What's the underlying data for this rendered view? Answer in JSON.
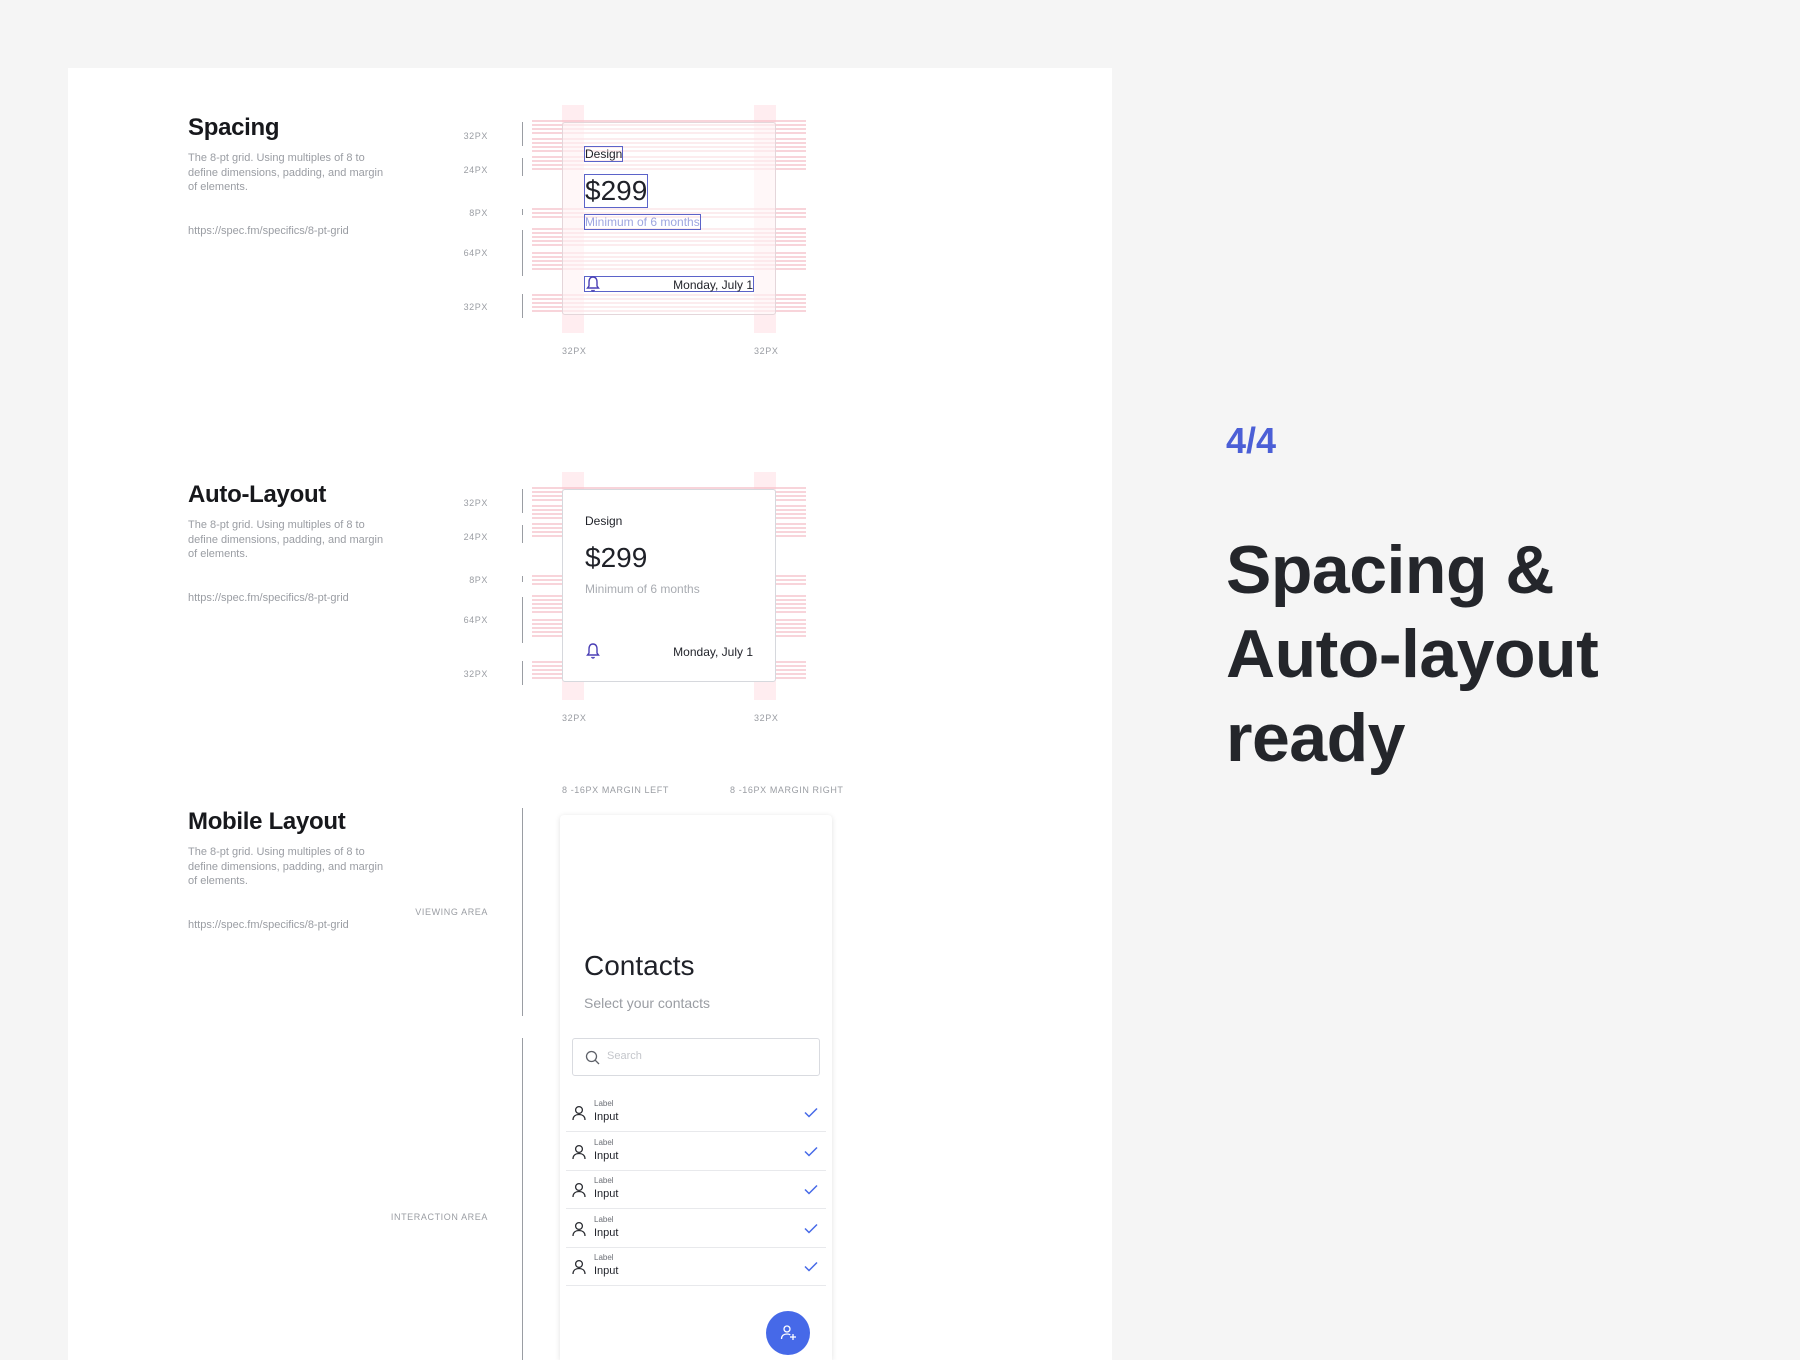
{
  "spacing": {
    "title": "Spacing",
    "desc": "The 8-pt grid. Using multiples of 8 to define dimensions, padding, and margin of elements.",
    "link": "https://spec.fm/specifics/8-pt-grid",
    "measures": [
      "32PX",
      "24PX",
      "8PX",
      "64PX",
      "32PX"
    ],
    "bottom_left": "32PX",
    "bottom_right": "32PX",
    "card": {
      "label": "Design",
      "price": "$299",
      "note": "Minimum of 6 months",
      "date": "Monday, July 1",
      "bell_icon": "bell-icon"
    }
  },
  "autolayout": {
    "title": "Auto-Layout",
    "desc": "The 8-pt grid. Using multiples of 8 to define dimensions, padding, and margin of elements.",
    "link": "https://spec.fm/specifics/8-pt-grid",
    "measures": [
      "32PX",
      "24PX",
      "8PX",
      "64PX",
      "32PX"
    ],
    "bottom_left": "32PX",
    "bottom_right": "32PX",
    "card": {
      "label": "Design",
      "price": "$299",
      "note": "Minimum of 6 months",
      "date": "Monday, July 1",
      "bell_icon": "bell-icon"
    }
  },
  "mobile": {
    "title": "Mobile Layout",
    "desc": "The 8-pt grid. Using multiples of 8 to define dimensions, padding, and margin of elements.",
    "link": "https://spec.fm/specifics/8-pt-grid",
    "margin_left": "8 -16PX MARGIN LEFT",
    "margin_right": "8 -16PX MARGIN RIGHT",
    "viewing_area": "VIEWING AREA",
    "interaction_area": "INTERACTION AREA",
    "phone": {
      "title": "Contacts",
      "subtitle": "Select your contacts",
      "search_placeholder": "Search",
      "rows": [
        {
          "label": "Label",
          "input": "Input"
        },
        {
          "label": "Label",
          "input": "Input"
        },
        {
          "label": "Label",
          "input": "Input"
        },
        {
          "label": "Label",
          "input": "Input"
        },
        {
          "label": "Label",
          "input": "Input"
        }
      ],
      "fab_icon": "add-user-icon"
    }
  },
  "hero": {
    "count": "4/4",
    "title_line1": "Spacing &",
    "title_line2": "Auto-layout",
    "title_line3": "ready"
  },
  "colors": {
    "accent": "#4b5fd6",
    "fab": "#4669e8",
    "guide": "#f2a9b5",
    "outline": "#5b63c9"
  }
}
